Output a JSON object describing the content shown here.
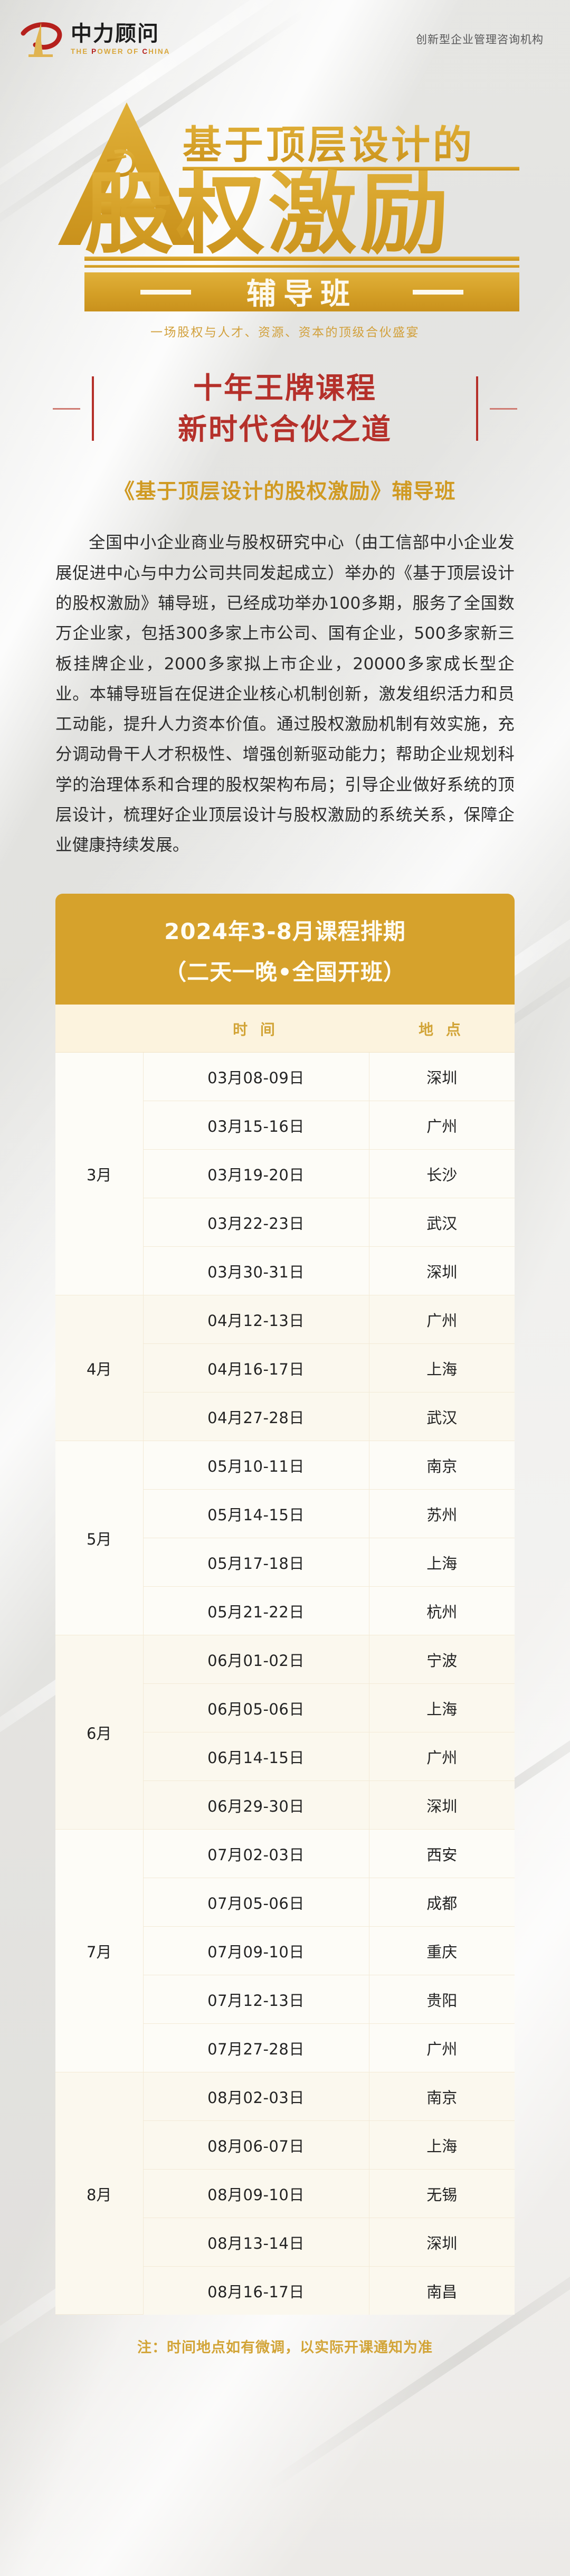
{
  "header": {
    "logo_cn": "中力顾问",
    "logo_en_parts": [
      "THE ",
      "P",
      "OWER OF ",
      "C",
      "HINA"
    ],
    "tagline": "创新型企业管理咨询机构"
  },
  "hero": {
    "line_top": "基于顶层设计的",
    "line_main": "股权激励",
    "badge": "辅导班",
    "subtitle": "一场股权与人才、资源、资本的顶级合伙盛宴"
  },
  "headline": {
    "line1": "十年王牌课程",
    "line2": "新时代合伙之道",
    "course_name": "《基于顶层设计的股权激励》辅导班"
  },
  "intro": {
    "paragraph": "全国中小企业商业与股权研究中心（由工信部中小企业发展促进中心与中力公司共同发起成立）举办的《基于顶层设计的股权激励》辅导班，已经成功举办100多期，服务了全国数万企业家，包括300多家上市公司、国有企业，500多家新三板挂牌企业，2000多家拟上市企业，20000多家成长型企业。本辅导班旨在促进企业核心机制创新，激发组织活力和员工动能，提升人力资本价值。通过股权激励机制有效实施，充分调动骨干人才积极性、增强创新驱动能力；帮助企业规划科学的治理体系和合理的股权架构布局；引导企业做好系统的顶层设计，梳理好企业顶层设计与股权激励的系统关系，保障企业健康持续发展。"
  },
  "schedule": {
    "title_line1": "2024年3-8月课程排期",
    "title_line2": "（二天一晚•全国开班）",
    "columns": {
      "month": "",
      "time": "时 间",
      "place": "地 点"
    },
    "note": "注：时间地点如有微调，以实际开课通知为准",
    "months": [
      {
        "label": "3月",
        "tint": false,
        "rows": [
          {
            "date": "03月08-09日",
            "city": "深圳"
          },
          {
            "date": "03月15-16日",
            "city": "广州"
          },
          {
            "date": "03月19-20日",
            "city": "长沙"
          },
          {
            "date": "03月22-23日",
            "city": "武汉"
          },
          {
            "date": "03月30-31日",
            "city": "深圳"
          }
        ]
      },
      {
        "label": "4月",
        "tint": true,
        "rows": [
          {
            "date": "04月12-13日",
            "city": "广州"
          },
          {
            "date": "04月16-17日",
            "city": "上海"
          },
          {
            "date": "04月27-28日",
            "city": "武汉"
          }
        ]
      },
      {
        "label": "5月",
        "tint": false,
        "rows": [
          {
            "date": "05月10-11日",
            "city": "南京"
          },
          {
            "date": "05月14-15日",
            "city": "苏州"
          },
          {
            "date": "05月17-18日",
            "city": "上海"
          },
          {
            "date": "05月21-22日",
            "city": "杭州"
          }
        ]
      },
      {
        "label": "6月",
        "tint": true,
        "rows": [
          {
            "date": "06月01-02日",
            "city": "宁波"
          },
          {
            "date": "06月05-06日",
            "city": "上海"
          },
          {
            "date": "06月14-15日",
            "city": "广州"
          },
          {
            "date": "06月29-30日",
            "city": "深圳"
          }
        ]
      },
      {
        "label": "7月",
        "tint": false,
        "rows": [
          {
            "date": "07月02-03日",
            "city": "西安"
          },
          {
            "date": "07月05-06日",
            "city": "成都"
          },
          {
            "date": "07月09-10日",
            "city": "重庆"
          },
          {
            "date": "07月12-13日",
            "city": "贵阳"
          },
          {
            "date": "07月27-28日",
            "city": "广州"
          }
        ]
      },
      {
        "label": "8月",
        "tint": true,
        "rows": [
          {
            "date": "08月02-03日",
            "city": "南京"
          },
          {
            "date": "08月06-07日",
            "city": "上海"
          },
          {
            "date": "08月09-10日",
            "city": "无锡"
          },
          {
            "date": "08月13-14日",
            "city": "深圳"
          },
          {
            "date": "08月16-17日",
            "city": "南昌"
          }
        ]
      }
    ]
  },
  "colors": {
    "gold": "#d6a22c",
    "gold_text": "#d2a437",
    "red": "#b5302a",
    "logo_red": "#b5201c",
    "table_bg": "#fdfcf7",
    "table_head_bg": "#fcf3de"
  }
}
